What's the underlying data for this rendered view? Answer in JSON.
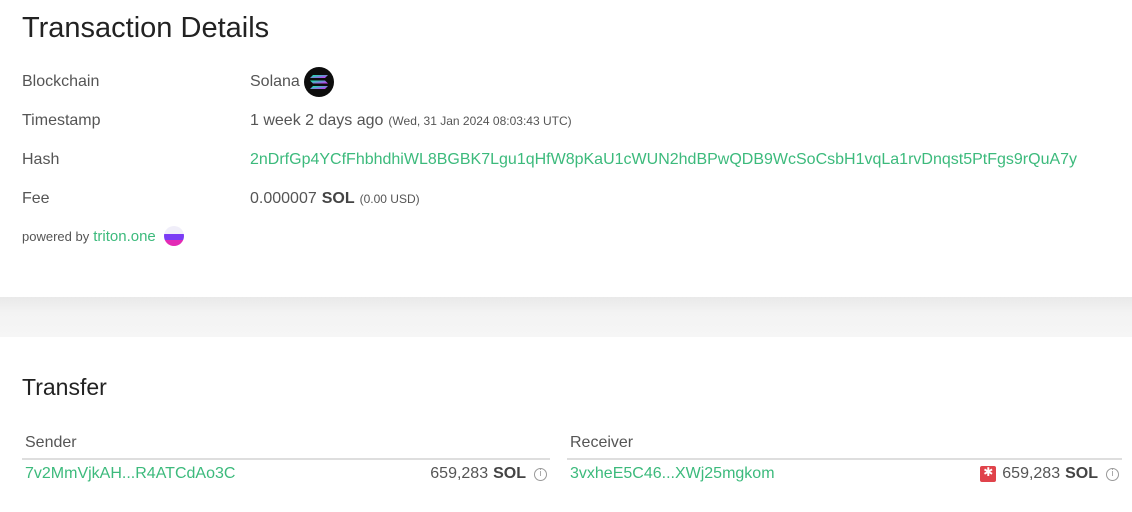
{
  "page": {
    "title": "Transaction Details"
  },
  "details": {
    "blockchain": {
      "label": "Blockchain",
      "value": "Solana",
      "icon": "solana-logo-icon"
    },
    "timestamp": {
      "label": "Timestamp",
      "relative": "1 week 2 days ago",
      "absolute": "(Wed, 31 Jan 2024 08:03:43 UTC)"
    },
    "hash": {
      "label": "Hash",
      "value": "2nDrfGp4YCfFhbhdhiWL8BGBK7Lgu1qHfW8pKaU1cWUN2hdBPwQDB9WcSoCsbH1vqLa1rvDnqst5PtFgs9rQuA7y"
    },
    "fee": {
      "label": "Fee",
      "amount": "0.000007",
      "unit": "SOL",
      "usd": "(0.00 USD)"
    }
  },
  "powered": {
    "prefix": "powered by",
    "link": "triton.one",
    "icon": "triton-logo-icon"
  },
  "transfer": {
    "title": "Transfer",
    "sender": {
      "header": "Sender",
      "address": "7v2MmVjkAH...R4ATCdAo3C",
      "amount": "659,283",
      "unit": "SOL"
    },
    "receiver": {
      "header": "Receiver",
      "address": "3vxheE5C46...XWj25mgkom",
      "amount": "659,283",
      "unit": "SOL",
      "flag_icon": "alert-icon"
    }
  },
  "colors": {
    "link": "#3cba7c",
    "alert": "#e0434b"
  }
}
